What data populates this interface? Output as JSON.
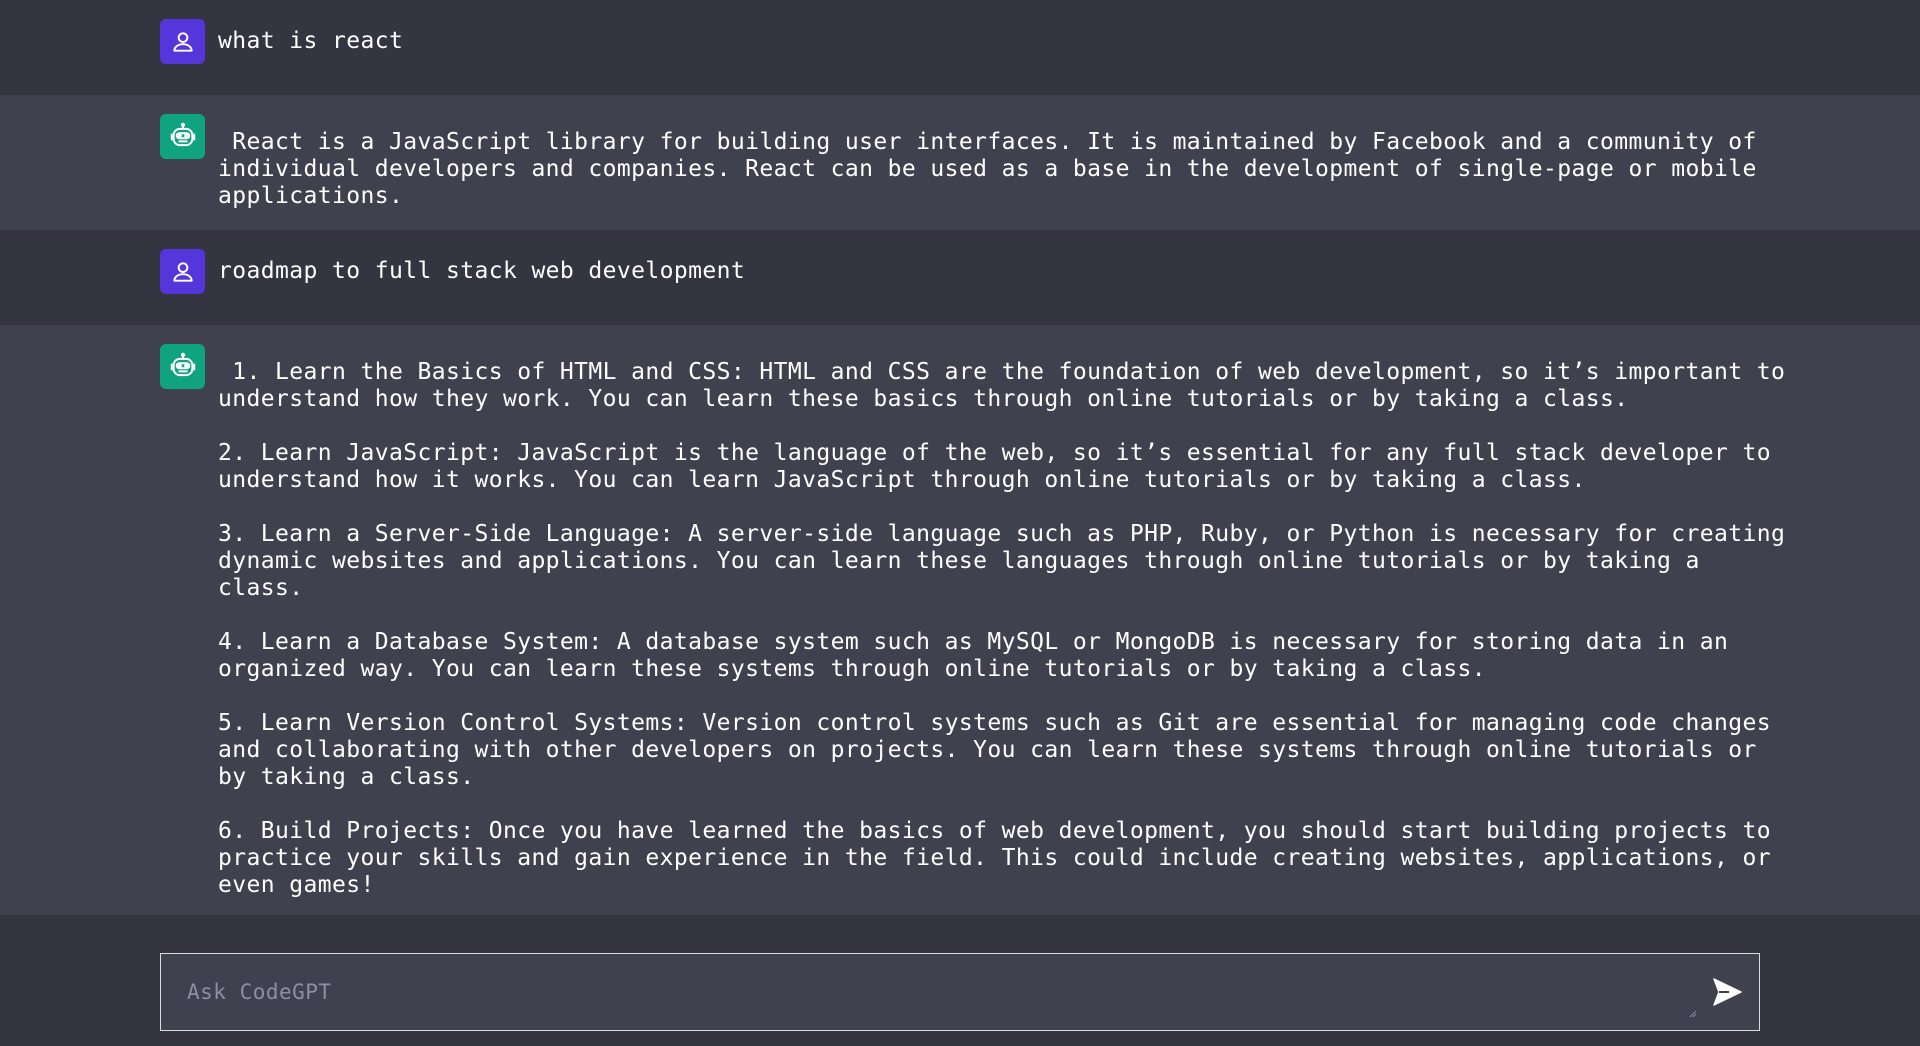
{
  "conversation": {
    "messages": [
      {
        "role": "user",
        "avatar_icon": "user-icon",
        "text": "what is react"
      },
      {
        "role": "bot",
        "avatar_icon": "robot-icon",
        "text": " React is a JavaScript library for building user interfaces. It is maintained by Facebook and a community of individual developers and companies. React can be used as a base in the development of single-page or mobile applications."
      },
      {
        "role": "user",
        "avatar_icon": "user-icon",
        "text": "roadmap to full stack web development"
      },
      {
        "role": "bot",
        "avatar_icon": "robot-icon",
        "text": " 1. Learn the Basics of HTML and CSS: HTML and CSS are the foundation of web development, so it’s important to understand how they work. You can learn these basics through online tutorials or by taking a class.\n\n2. Learn JavaScript: JavaScript is the language of the web, so it’s essential for any full stack developer to understand how it works. You can learn JavaScript through online tutorials or by taking a class.\n\n3. Learn a Server-Side Language: A server-side language such as PHP, Ruby, or Python is necessary for creating dynamic websites and applications. You can learn these languages through online tutorials or by taking a class.\n\n4. Learn a Database System: A database system such as MySQL or MongoDB is necessary for storing data in an organized way. You can learn these systems through online tutorials or by taking a class.\n\n5. Learn Version Control Systems: Version control systems such as Git are essential for managing code changes and collaborating with other developers on projects. You can learn these systems through online tutorials or by taking a class.\n\n6. Build Projects: Once you have learned the basics of web development, you should start building projects to practice your skills and gain experience in the field. This could include creating websites, applications, or even games!"
      }
    ]
  },
  "composer": {
    "placeholder": "Ask CodeGPT",
    "value": "",
    "send_icon": "send-icon"
  },
  "colors": {
    "background": "#343541",
    "bot_row_background": "#40414f",
    "user_avatar": "#5436da",
    "bot_avatar": "#10a37f"
  }
}
